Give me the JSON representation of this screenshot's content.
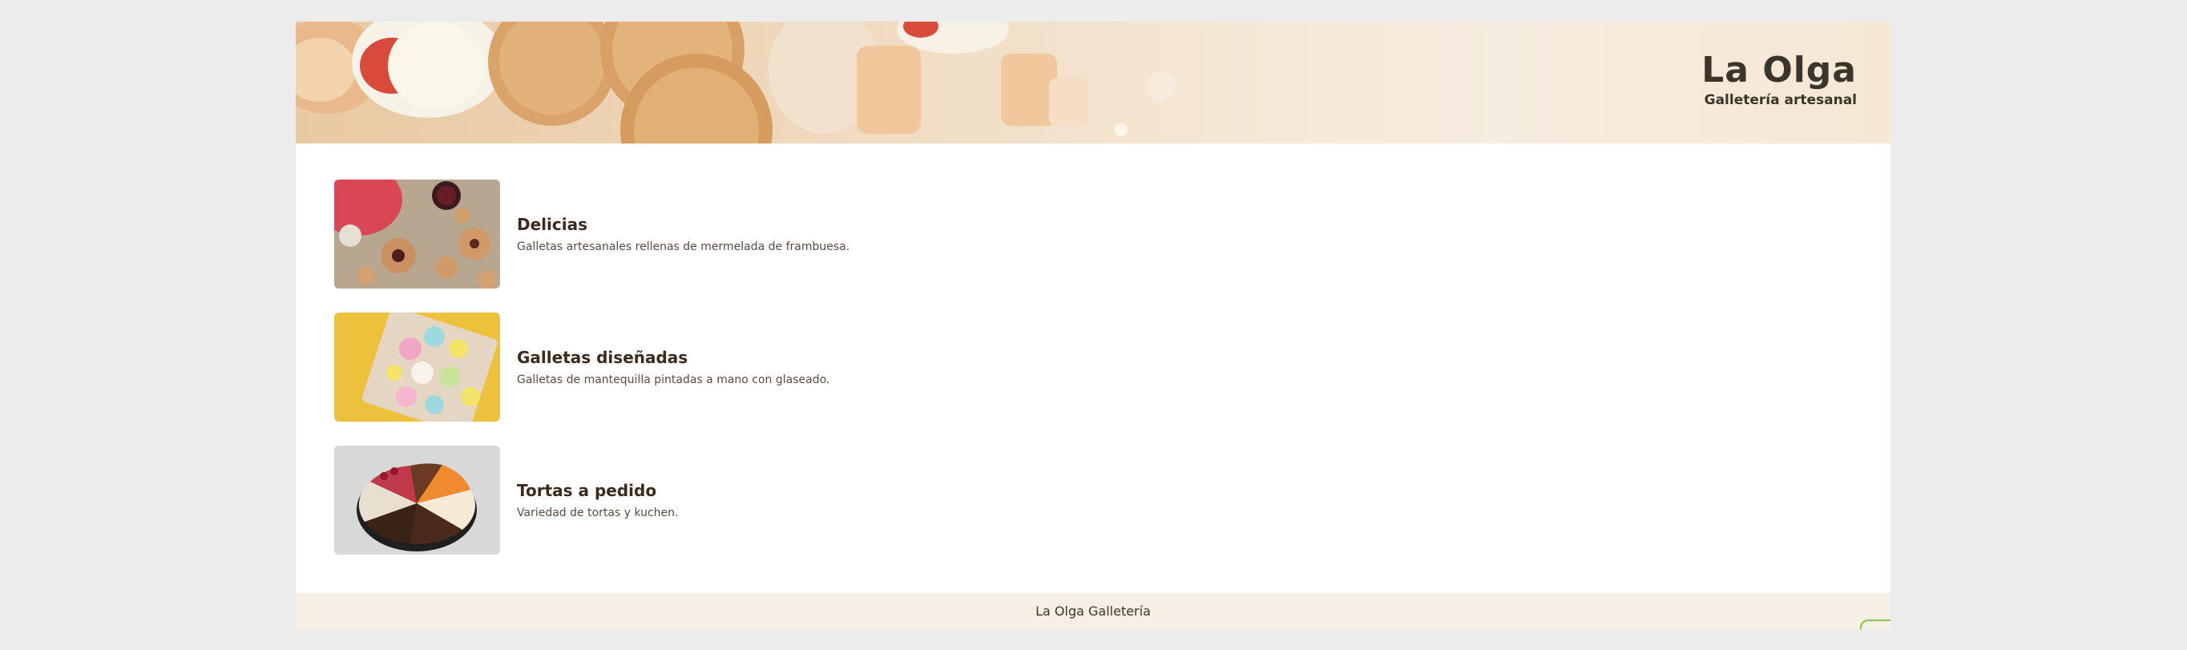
{
  "header": {
    "brand_name": "La Olga",
    "tagline": "Galletería artesanal"
  },
  "products": [
    {
      "title": "Delicias",
      "description": "Galletas artesanales rellenas de mermelada de frambuesa.",
      "image_icon": "linzer-cookies-photo"
    },
    {
      "title": "Galletas diseñadas",
      "description": "Galletas de mantequilla pintadas a mano con glaseado.",
      "image_icon": "decorated-cookies-photo"
    },
    {
      "title": "Tortas a pedido",
      "description": "Variedad de tortas y kuchen.",
      "image_icon": "cake-slices-photo"
    }
  ],
  "footer": {
    "text": "La Olga Galletería"
  },
  "colors": {
    "page_background": "#ececec",
    "content_background": "#ffffff",
    "banner_tone": "#f4e6d2",
    "footer_background": "#f6efe5",
    "brand_text": "#3a3528",
    "product_title": "#3b2a1e",
    "accent_corner": "#8bc34a"
  }
}
